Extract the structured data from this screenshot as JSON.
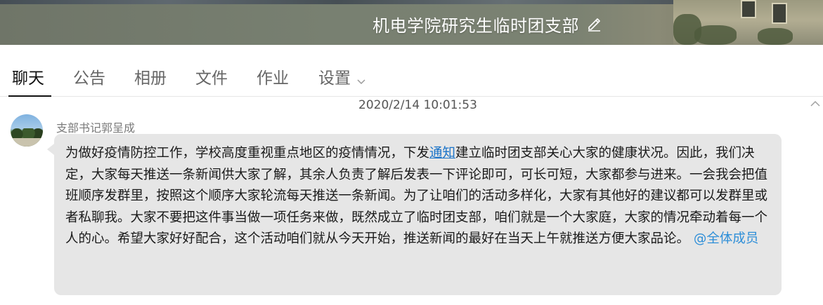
{
  "header": {
    "group_name": "机电学院研究生临时团支部"
  },
  "tabs": [
    {
      "label": "聊天",
      "active": true
    },
    {
      "label": "公告"
    },
    {
      "label": "相册"
    },
    {
      "label": "文件"
    },
    {
      "label": "作业"
    },
    {
      "label": "设置"
    }
  ],
  "chat": {
    "timestamp": "2020/2/14 10:01:53",
    "messages": [
      {
        "sender": "支部书记郭呈成",
        "text_before_link": "为做好疫情防控工作，学校高度重视重点地区的疫情情况，下发",
        "link_text": "通知",
        "text_after_link": "建立临时团支部关心大家的健康状况。因此，我们决定，大家每天推送一条新闻供大家了解，其余人负责了解后发表一下评论即可，可长可短，大家都参与进来。一会我会把值班顺序发群里，按照这个顺序大家轮流每天推送一条新闻。为了让咱们的活动多样化，大家有其他好的建议都可以发群里或者私聊我。大家不要把这件事当做一项任务来做，既然成立了临时团支部，咱们就是一个大家庭，大家的情况牵动着每一个人的心。希望大家好好配合，这个活动咱们就从今天开始，推送新闻的最好在当天上午就推送方便大家品论。",
        "mention": "@全体成员"
      }
    ]
  },
  "icons": {
    "edit": "pencil-icon",
    "settings_dropdown": "chevron-down-icon",
    "collapse": "chevron-up-icon"
  },
  "colors": {
    "banner": "#788071",
    "bubble": "#e6e6e6",
    "link": "#1a73c8",
    "mention": "#2f8fd8"
  }
}
